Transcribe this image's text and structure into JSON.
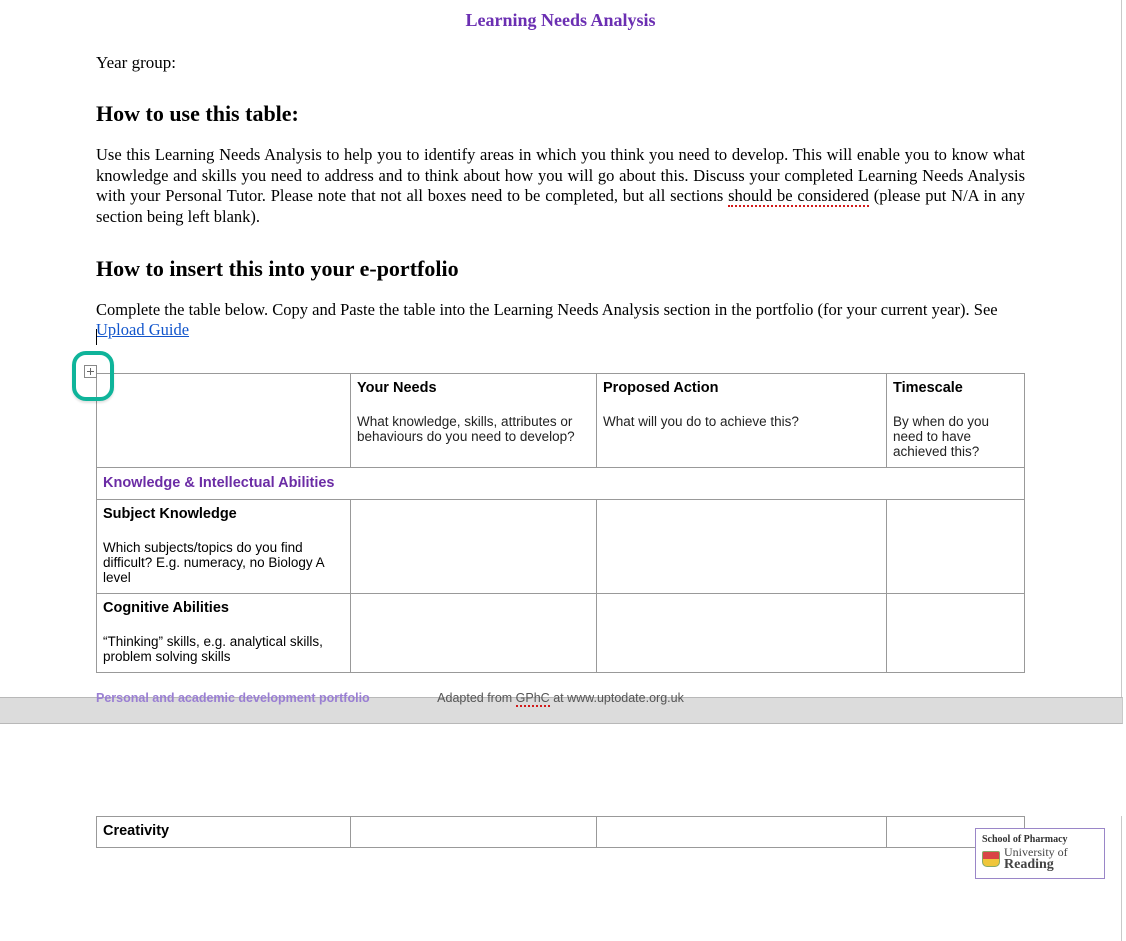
{
  "title": "Learning Needs Analysis",
  "year_group_label": "Year group:",
  "section1_heading": "How to use this table:",
  "para1_a": "Use this Learning Needs Analysis to help you to identify areas in which you think you need to develop.  This will enable you to know what knowledge and skills you need to address and to think about how you will go about this.  Discuss your completed Learning Needs Analysis with your Personal Tutor. Please note that not all boxes need to be completed, but all sections ",
  "para1_spell": "should be considered",
  "para1_b": " (please put N/A in any section being left blank).",
  "section2_heading": "How to insert this into your e-portfolio",
  "para2_a": "Complete the table below. Copy and Paste the table into the Learning Needs Analysis section in the portfolio (for your current year). See ",
  "para2_link": "Upload Guide",
  "table": {
    "headers": [
      {
        "title": "",
        "sub": ""
      },
      {
        "title": "Your Needs",
        "sub": "What knowledge, skills, attributes or behaviours do you need to develop?"
      },
      {
        "title": "Proposed Action",
        "sub": "What will you do to achieve this?"
      },
      {
        "title": "Timescale",
        "sub": "By when do you need to have achieved this?"
      }
    ],
    "category1": "Knowledge & Intellectual Abilities",
    "rows": [
      {
        "title": "Subject Knowledge",
        "sub": "Which subjects/topics do you find difficult? E.g. numeracy, no Biology A level"
      },
      {
        "title": "Cognitive Abilities",
        "sub": "“Thinking” skills, e.g. analytical skills, problem solving skills"
      }
    ],
    "page2_row": {
      "title": "Creativity",
      "sub": ""
    }
  },
  "footer": {
    "left": "Personal and academic development portfolio",
    "center_a": "Adapted from ",
    "center_spell": "GPhC",
    "center_b": " at www.uptodate.org.uk"
  },
  "badge": {
    "line1": "School of Pharmacy",
    "uni_top": "University of",
    "uni_bottom": "Reading"
  }
}
